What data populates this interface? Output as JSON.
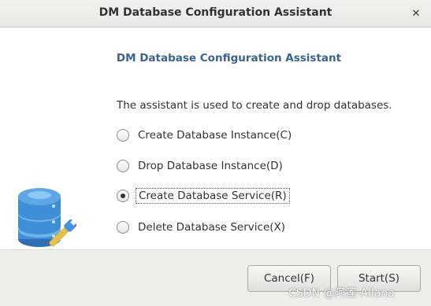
{
  "window": {
    "title": "DM Database Configuration Assistant",
    "close_glyph": "✕"
  },
  "main": {
    "heading": "DM Database Configuration Assistant",
    "intro": "The assistant is used to create and drop databases.",
    "options": [
      {
        "label": "Create Database Instance(C)",
        "checked": false
      },
      {
        "label": "Drop Database Instance(D)",
        "checked": false
      },
      {
        "label": "Create Database Service(R)",
        "checked": true
      },
      {
        "label": "Delete Database Service(X)",
        "checked": false
      }
    ],
    "icon": "database-wrench-icon"
  },
  "footer": {
    "cancel_label": "Cancel(F)",
    "start_label": "Start(S)"
  },
  "watermark": "CSDN @阿莲-Allana",
  "colors": {
    "heading": "#3b6391",
    "footer_bg": "#eeeeec",
    "db_icon_blue": "#3f8fd8"
  }
}
